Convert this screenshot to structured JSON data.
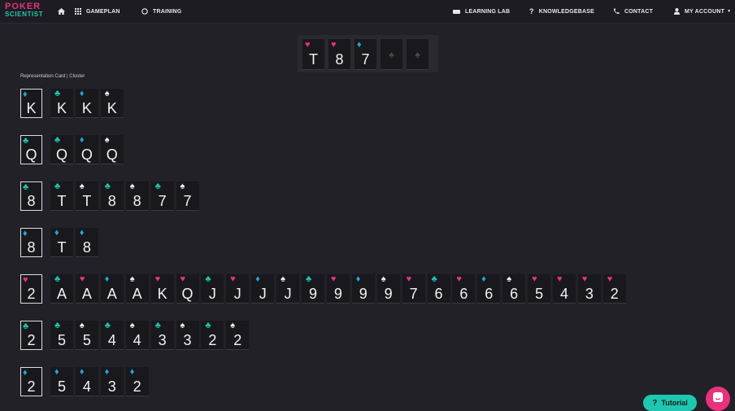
{
  "nav": {
    "logo_line1": "POKER",
    "logo_line2": "SCIENTIST",
    "gameplan": "GAMEPLAN",
    "training": "TRAINING",
    "learning_lab": "LEARNING LAB",
    "knowledgebase": "KNOWLEDGEBASE",
    "contact": "CONTACT",
    "my_account": "MY ACCOUNT"
  },
  "board": {
    "cards": [
      {
        "rank": "T",
        "suit": "h"
      },
      {
        "rank": "8",
        "suit": "h"
      },
      {
        "rank": "7",
        "suit": "d"
      },
      {
        "rank": "",
        "suit": "empty"
      },
      {
        "rank": "",
        "suit": "empty"
      }
    ]
  },
  "header": {
    "label": "Representation Card | Cluster"
  },
  "clusters": [
    {
      "rep": {
        "rank": "K",
        "suit": "d"
      },
      "cards": [
        {
          "rank": "K",
          "suit": "c"
        },
        {
          "rank": "K",
          "suit": "d"
        },
        {
          "rank": "K",
          "suit": "s"
        }
      ]
    },
    {
      "rep": {
        "rank": "Q",
        "suit": "c"
      },
      "cards": [
        {
          "rank": "Q",
          "suit": "c"
        },
        {
          "rank": "Q",
          "suit": "d"
        },
        {
          "rank": "Q",
          "suit": "s"
        }
      ]
    },
    {
      "rep": {
        "rank": "8",
        "suit": "c"
      },
      "cards": [
        {
          "rank": "T",
          "suit": "c"
        },
        {
          "rank": "T",
          "suit": "s"
        },
        {
          "rank": "8",
          "suit": "c"
        },
        {
          "rank": "8",
          "suit": "s"
        },
        {
          "rank": "7",
          "suit": "c"
        },
        {
          "rank": "7",
          "suit": "s"
        }
      ]
    },
    {
      "rep": {
        "rank": "8",
        "suit": "d"
      },
      "cards": [
        {
          "rank": "T",
          "suit": "d"
        },
        {
          "rank": "8",
          "suit": "d"
        }
      ]
    },
    {
      "rep": {
        "rank": "2",
        "suit": "h"
      },
      "cards": [
        {
          "rank": "A",
          "suit": "c"
        },
        {
          "rank": "A",
          "suit": "h"
        },
        {
          "rank": "A",
          "suit": "d"
        },
        {
          "rank": "A",
          "suit": "s"
        },
        {
          "rank": "K",
          "suit": "h"
        },
        {
          "rank": "Q",
          "suit": "h"
        },
        {
          "rank": "J",
          "suit": "c"
        },
        {
          "rank": "J",
          "suit": "h"
        },
        {
          "rank": "J",
          "suit": "d"
        },
        {
          "rank": "J",
          "suit": "s"
        },
        {
          "rank": "9",
          "suit": "c"
        },
        {
          "rank": "9",
          "suit": "h"
        },
        {
          "rank": "9",
          "suit": "d"
        },
        {
          "rank": "9",
          "suit": "s"
        },
        {
          "rank": "7",
          "suit": "h"
        },
        {
          "rank": "6",
          "suit": "c"
        },
        {
          "rank": "6",
          "suit": "h"
        },
        {
          "rank": "6",
          "suit": "d"
        },
        {
          "rank": "6",
          "suit": "s"
        },
        {
          "rank": "5",
          "suit": "h"
        },
        {
          "rank": "4",
          "suit": "h"
        },
        {
          "rank": "3",
          "suit": "h"
        },
        {
          "rank": "2",
          "suit": "h"
        }
      ]
    },
    {
      "rep": {
        "rank": "2",
        "suit": "c"
      },
      "cards": [
        {
          "rank": "5",
          "suit": "c"
        },
        {
          "rank": "5",
          "suit": "s"
        },
        {
          "rank": "4",
          "suit": "c"
        },
        {
          "rank": "4",
          "suit": "s"
        },
        {
          "rank": "3",
          "suit": "c"
        },
        {
          "rank": "3",
          "suit": "s"
        },
        {
          "rank": "2",
          "suit": "c"
        },
        {
          "rank": "2",
          "suit": "s"
        }
      ]
    },
    {
      "rep": {
        "rank": "2",
        "suit": "d"
      },
      "cards": [
        {
          "rank": "5",
          "suit": "d"
        },
        {
          "rank": "4",
          "suit": "d"
        },
        {
          "rank": "3",
          "suit": "d"
        },
        {
          "rank": "2",
          "suit": "d"
        }
      ]
    }
  ],
  "floating": {
    "tutorial_label": "Tutorial",
    "tutorial_icon": "?"
  },
  "colors": {
    "hearts": "#e8327c",
    "diamonds": "#1ea7e0",
    "clubs": "#1ec8b0",
    "spades": "#f2f2f2",
    "background": "#222128"
  }
}
